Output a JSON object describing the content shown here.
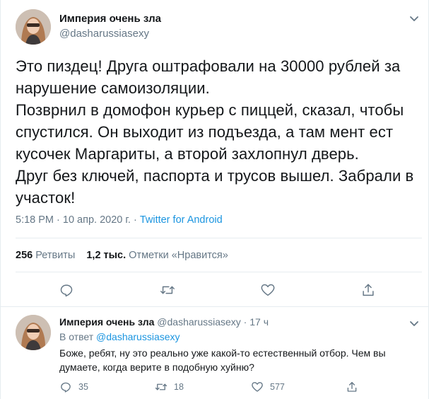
{
  "tweet": {
    "author_name": "Империя очень зла",
    "author_handle": "@dasharussiasexy",
    "text": "Это пиздец! Друга оштрафовали на 30000 рублей за нарушение самоизоляции.\nПозврнил в домофон курьер с пиццей, сказал, чтобы спустился. Он выходит из подъезда, а там мент ест кусочек Маргариты, а второй захлопнул дверь.\nДруг без ключей, паспорта и трусов вышел. Забрали в участок!",
    "timestamp": "5:18 PM · 10 апр. 2020 г. · ",
    "source": "Twitter for Android",
    "retweets_count": "256",
    "retweets_label": "Ретвиты",
    "likes_count": "1,2 тыс.",
    "likes_label": "Отметки «Нравится»"
  },
  "icons": {
    "caret": "chevron-down-icon",
    "reply": "reply-icon",
    "retweet": "retweet-icon",
    "like": "heart-icon",
    "share": "share-icon"
  },
  "reply": {
    "author_name": "Империя очень зла",
    "author_handle": "@dasharussiasexy",
    "time_sep": " · ",
    "time": "17 ч",
    "reply_to_label": "В ответ ",
    "reply_to_handle": "@dasharussiasexy",
    "text": "Боже, ребят, ну это реально уже какой-то естественный отбор. Чем вы думаете, когда верите в подобную хуйню?",
    "reply_count": "35",
    "retweet_count": "18",
    "like_count": "577"
  },
  "colors": {
    "text": "#14171a",
    "secondary": "#657786",
    "link": "#1b95e0",
    "border": "#e6ecf0"
  }
}
